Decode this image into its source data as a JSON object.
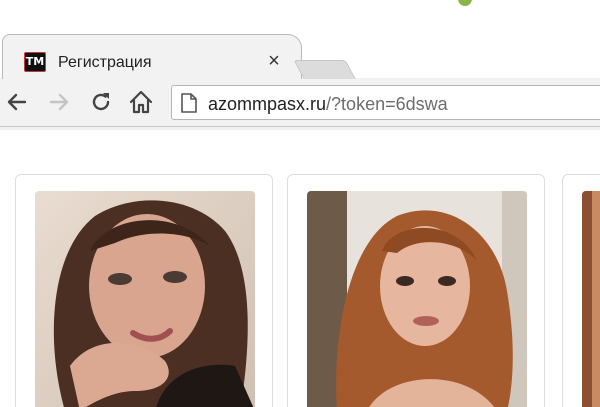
{
  "browser": {
    "tab": {
      "favicon_text": "TM",
      "title": "Регистрация",
      "close_symbol": "×"
    },
    "address_bar": {
      "domain": "azommpasx.ru",
      "path": "/?token=6dswa"
    },
    "icons": {
      "back": "back-arrow-icon",
      "forward": "forward-arrow-icon",
      "reload": "reload-icon",
      "home": "home-icon",
      "page": "page-icon"
    }
  },
  "page": {
    "cards": [
      {
        "photo": "portrait photo of woman with dark brown hair"
      },
      {
        "photo": "portrait photo of woman with auburn hair"
      },
      {
        "photo": "portrait photo (cropped)"
      }
    ]
  },
  "colors": {
    "chrome_bg": "#f2f2f2",
    "tab_border": "#b8b8b8",
    "card_border": "#dddddd"
  }
}
